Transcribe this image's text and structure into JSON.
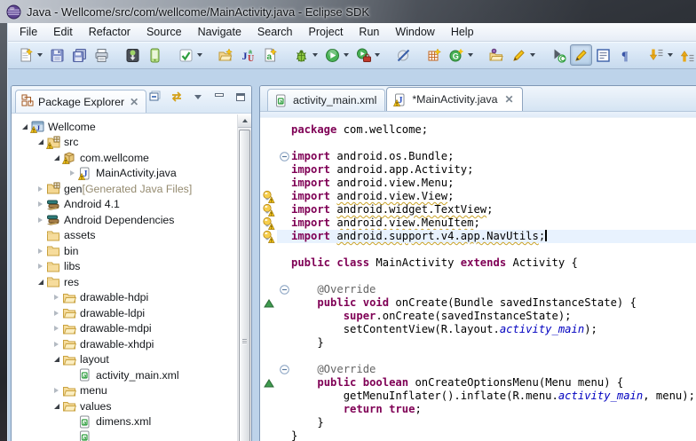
{
  "window": {
    "title": "Java - Wellcome/src/com/wellcome/MainActivity.java - Eclipse SDK",
    "app_icon": "eclipse-icon"
  },
  "menu_bar": {
    "items": [
      "File",
      "Edit",
      "Refactor",
      "Source",
      "Navigate",
      "Search",
      "Project",
      "Run",
      "Window",
      "Help"
    ]
  },
  "toolbar": {
    "items": [
      {
        "type": "button",
        "name": "new-wizard",
        "icon": "new-doc",
        "dropdown": true
      },
      {
        "type": "button",
        "name": "save",
        "icon": "save"
      },
      {
        "type": "button",
        "name": "save-all",
        "icon": "save-all"
      },
      {
        "type": "button",
        "name": "print",
        "icon": "print"
      },
      {
        "type": "sep"
      },
      {
        "type": "button",
        "name": "android-sdk-manager",
        "icon": "android-sdk"
      },
      {
        "type": "button",
        "name": "avd-manager",
        "icon": "avd"
      },
      {
        "type": "sep"
      },
      {
        "type": "button",
        "name": "lint-check",
        "icon": "check",
        "dropdown": true
      },
      {
        "type": "sep"
      },
      {
        "type": "button",
        "name": "new-java-project",
        "icon": "folder-new"
      },
      {
        "type": "button",
        "name": "new-junit-test",
        "icon": "junit"
      },
      {
        "type": "button",
        "name": "new-android-xml",
        "icon": "xml-new"
      },
      {
        "type": "sep"
      },
      {
        "type": "button",
        "name": "debug",
        "icon": "bug",
        "dropdown": true
      },
      {
        "type": "button",
        "name": "run",
        "icon": "play",
        "dropdown": true
      },
      {
        "type": "button",
        "name": "run-external-tools",
        "icon": "play-tools",
        "dropdown": true
      },
      {
        "type": "sep"
      },
      {
        "type": "button",
        "name": "skip-breakpoints",
        "icon": "slash"
      },
      {
        "type": "sep"
      },
      {
        "type": "button",
        "name": "new-android-project",
        "icon": "grid-new"
      },
      {
        "type": "button",
        "name": "opengl-trace",
        "icon": "gplus",
        "dropdown": true
      },
      {
        "type": "sep"
      },
      {
        "type": "button",
        "name": "open-type",
        "icon": "open-folder"
      },
      {
        "type": "button",
        "name": "mark-element",
        "icon": "pencil",
        "dropdown": true
      },
      {
        "type": "sep"
      },
      {
        "type": "button",
        "name": "toggle-breadcrumb",
        "icon": "breadcrumb"
      },
      {
        "type": "button",
        "name": "toggle-mark-occurrences",
        "icon": "highlighter",
        "toggled": true
      },
      {
        "type": "button",
        "name": "show-source",
        "icon": "source-box"
      },
      {
        "type": "button",
        "name": "show-whitespace",
        "icon": "pilcrow"
      },
      {
        "type": "sep"
      },
      {
        "type": "button",
        "name": "next-annotation",
        "icon": "arrow-down-doc",
        "dropdown": true
      },
      {
        "type": "button",
        "name": "previous-annotation",
        "icon": "arrow-up-doc"
      }
    ]
  },
  "package_explorer": {
    "title": "Package Explorer",
    "header_icons": [
      "collapse-all",
      "link-with-editor",
      "view-menu",
      "minimize",
      "maximize"
    ],
    "tree": [
      {
        "label": "Wellcome",
        "depth": 0,
        "icon": "project-warning",
        "expand": "open"
      },
      {
        "label": "src",
        "depth": 1,
        "icon": "src-folder-warning",
        "expand": "open"
      },
      {
        "label": "com.wellcome",
        "depth": 2,
        "icon": "package-warning",
        "expand": "open"
      },
      {
        "label": "MainActivity.java",
        "depth": 3,
        "icon": "java-file-warning",
        "expand": "closed"
      },
      {
        "label": "gen",
        "suffix": " [Generated Java Files]",
        "depth": 1,
        "icon": "src-folder",
        "expand": "closed"
      },
      {
        "label": "Android 4.1",
        "depth": 1,
        "icon": "library",
        "expand": "closed"
      },
      {
        "label": "Android Dependencies",
        "depth": 1,
        "icon": "library",
        "expand": "closed"
      },
      {
        "label": "assets",
        "depth": 1,
        "icon": "folder",
        "expand": "none"
      },
      {
        "label": "bin",
        "depth": 1,
        "icon": "folder",
        "expand": "closed"
      },
      {
        "label": "libs",
        "depth": 1,
        "icon": "folder",
        "expand": "closed"
      },
      {
        "label": "res",
        "depth": 1,
        "icon": "folder",
        "expand": "open"
      },
      {
        "label": "drawable-hdpi",
        "depth": 2,
        "icon": "open-folder-tree",
        "expand": "closed"
      },
      {
        "label": "drawable-ldpi",
        "depth": 2,
        "icon": "open-folder-tree",
        "expand": "closed"
      },
      {
        "label": "drawable-mdpi",
        "depth": 2,
        "icon": "open-folder-tree",
        "expand": "closed"
      },
      {
        "label": "drawable-xhdpi",
        "depth": 2,
        "icon": "open-folder-tree",
        "expand": "closed"
      },
      {
        "label": "layout",
        "depth": 2,
        "icon": "open-folder-tree",
        "expand": "open"
      },
      {
        "label": "activity_main.xml",
        "depth": 3,
        "icon": "xml-file",
        "expand": "none"
      },
      {
        "label": "menu",
        "depth": 2,
        "icon": "open-folder-tree",
        "expand": "closed"
      },
      {
        "label": "values",
        "depth": 2,
        "icon": "open-folder-tree",
        "expand": "open"
      },
      {
        "label": "dimens.xml",
        "depth": 3,
        "icon": "xml-file",
        "expand": "none"
      },
      {
        "label": "",
        "depth": 3,
        "icon": "xml-file",
        "expand": "none",
        "partial": true
      }
    ]
  },
  "editor": {
    "tabs": [
      {
        "label": "activity_main.xml",
        "icon": "xml-file",
        "active": false,
        "closable": false
      },
      {
        "label": "*MainActivity.java",
        "icon": "java-file-warning",
        "active": true,
        "closable": true
      }
    ],
    "code": {
      "lines": [
        {
          "seg": [
            [
              "package",
              "kw"
            ],
            [
              " com.wellcome;",
              "pl"
            ]
          ]
        },
        {
          "seg": []
        },
        {
          "fold": true,
          "seg": [
            [
              "import",
              "kw"
            ],
            [
              " android.os.Bundle;",
              "pl"
            ]
          ]
        },
        {
          "seg": [
            [
              "import",
              "kw"
            ],
            [
              " android.app.Activity;",
              "pl"
            ]
          ]
        },
        {
          "seg": [
            [
              "import",
              "kw"
            ],
            [
              " android.view.Menu;",
              "pl"
            ]
          ]
        },
        {
          "marker": "warning",
          "seg": [
            [
              "import",
              "kw"
            ],
            [
              " ",
              "pl"
            ],
            [
              "android.view.View",
              "pl sq"
            ],
            [
              ";",
              "pl"
            ]
          ]
        },
        {
          "marker": "warning",
          "seg": [
            [
              "import",
              "kw"
            ],
            [
              " ",
              "pl"
            ],
            [
              "android.widget.TextView",
              "pl sq"
            ],
            [
              ";",
              "pl"
            ]
          ]
        },
        {
          "marker": "warning",
          "seg": [
            [
              "import",
              "kw"
            ],
            [
              " ",
              "pl"
            ],
            [
              "android.view.MenuItem",
              "pl sq"
            ],
            [
              ";",
              "pl"
            ]
          ]
        },
        {
          "marker": "warning",
          "current": true,
          "cursor": true,
          "seg": [
            [
              "import",
              "kw"
            ],
            [
              " ",
              "pl"
            ],
            [
              "android.support.v4.app.NavUtils",
              "pl sq"
            ],
            [
              ";",
              "pl"
            ]
          ]
        },
        {
          "seg": []
        },
        {
          "seg": [
            [
              "public",
              "kw"
            ],
            [
              " ",
              "pl"
            ],
            [
              "class",
              "kw"
            ],
            [
              " MainActivity ",
              "pl"
            ],
            [
              "extends",
              "kw"
            ],
            [
              " Activity {",
              "pl"
            ]
          ]
        },
        {
          "seg": []
        },
        {
          "fold": true,
          "seg": [
            [
              "    @Override",
              "gr"
            ]
          ]
        },
        {
          "marker": "override",
          "seg": [
            [
              "    ",
              "pl"
            ],
            [
              "public",
              "kw"
            ],
            [
              " ",
              "pl"
            ],
            [
              "void",
              "kw"
            ],
            [
              " onCreate(Bundle savedInstanceState) {",
              "pl"
            ]
          ]
        },
        {
          "seg": [
            [
              "        ",
              "pl"
            ],
            [
              "super",
              "kw"
            ],
            [
              ".onCreate(savedInstanceState);",
              "pl"
            ]
          ]
        },
        {
          "seg": [
            [
              "        setContentView(R.layout.",
              "pl"
            ],
            [
              "activity_main",
              "bi"
            ],
            [
              ");",
              "pl"
            ]
          ]
        },
        {
          "seg": [
            [
              "    }",
              "pl"
            ]
          ]
        },
        {
          "seg": []
        },
        {
          "fold": true,
          "seg": [
            [
              "    @Override",
              "gr"
            ]
          ]
        },
        {
          "marker": "override",
          "seg": [
            [
              "    ",
              "pl"
            ],
            [
              "public",
              "kw"
            ],
            [
              " ",
              "pl"
            ],
            [
              "boolean",
              "kw"
            ],
            [
              " onCreateOptionsMenu(Menu menu) {",
              "pl"
            ]
          ]
        },
        {
          "seg": [
            [
              "        getMenuInflater().inflate(R.menu.",
              "pl"
            ],
            [
              "activity_main",
              "bi"
            ],
            [
              ", menu);",
              "pl"
            ]
          ]
        },
        {
          "seg": [
            [
              "        ",
              "pl"
            ],
            [
              "return",
              "kw"
            ],
            [
              " ",
              "pl"
            ],
            [
              "true",
              "kw"
            ],
            [
              ";",
              "pl"
            ]
          ]
        },
        {
          "seg": [
            [
              "    }",
              "pl"
            ]
          ]
        },
        {
          "seg": [
            [
              "}",
              "pl"
            ]
          ]
        }
      ]
    }
  },
  "colors": {
    "keyword": "#7f0055",
    "annotation_text": "#646464",
    "static_field": "#0000c0",
    "current_line": "#e8f2fe",
    "squiggle": "#c9a227",
    "warning_accent": "#f5c518",
    "workbench_background": "#bdd3ea"
  }
}
